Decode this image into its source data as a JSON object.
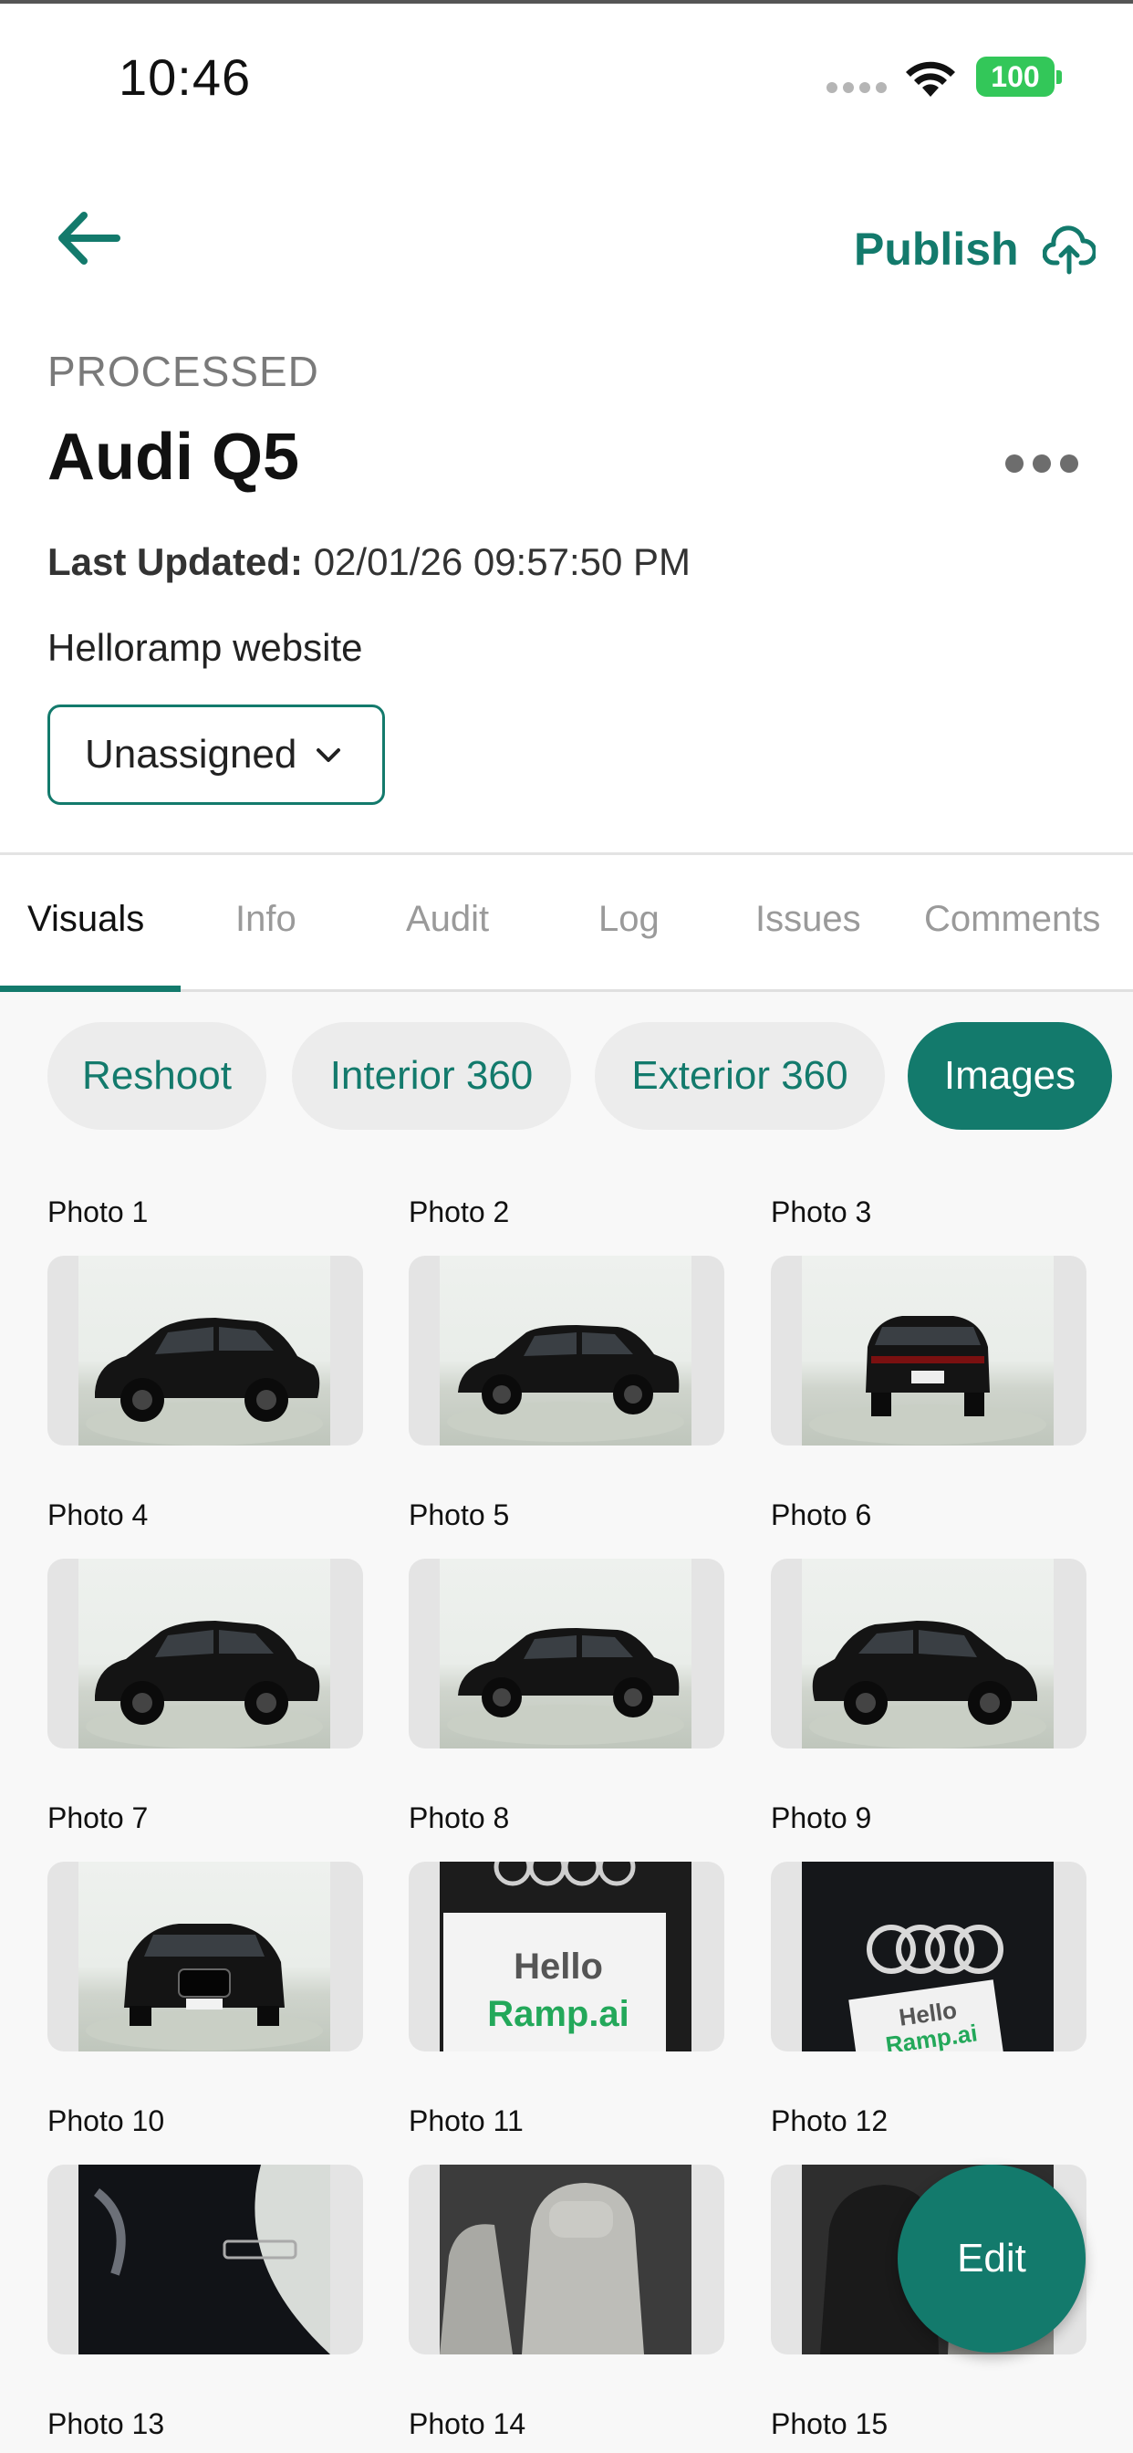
{
  "status_bar": {
    "time": "10:46",
    "battery": "100"
  },
  "header": {
    "publish_label": "Publish",
    "status": "PROCESSED",
    "title": "Audi Q5",
    "last_updated_label": "Last Updated:",
    "last_updated_value": "02/01/26 09:57:50 PM",
    "source": "Helloramp website",
    "assignee": "Unassigned"
  },
  "tabs": [
    "Visuals",
    "Info",
    "Audit",
    "Log",
    "Issues",
    "Comments"
  ],
  "active_tab": "Visuals",
  "chips": [
    "Reshoot",
    "Interior 360",
    "Exterior 360",
    "Images"
  ],
  "active_chip": "Images",
  "photos": [
    {
      "label": "Photo 1",
      "kind": "car-front-left"
    },
    {
      "label": "Photo 2",
      "kind": "car-side"
    },
    {
      "label": "Photo 3",
      "kind": "car-rear"
    },
    {
      "label": "Photo 4",
      "kind": "car-rear-left"
    },
    {
      "label": "Photo 5",
      "kind": "car-side"
    },
    {
      "label": "Photo 6",
      "kind": "car-front-right"
    },
    {
      "label": "Photo 7",
      "kind": "car-front"
    },
    {
      "label": "Photo 8",
      "kind": "dealer-plate-closeup"
    },
    {
      "label": "Photo 9",
      "kind": "badge-closeup"
    },
    {
      "label": "Photo 10",
      "kind": "badge-detail"
    },
    {
      "label": "Photo 11",
      "kind": "interior-seat"
    },
    {
      "label": "Photo 12",
      "kind": "interior-rear"
    },
    {
      "label": "Photo 13",
      "kind": "unknown"
    },
    {
      "label": "Photo 14",
      "kind": "unknown"
    },
    {
      "label": "Photo 15",
      "kind": "unknown"
    }
  ],
  "plate_text": [
    "Hello",
    "Ramp.ai"
  ],
  "fab_label": "Edit",
  "colors": {
    "accent": "#137a6c",
    "battery": "#33c759",
    "chip_bg": "#ececec"
  }
}
